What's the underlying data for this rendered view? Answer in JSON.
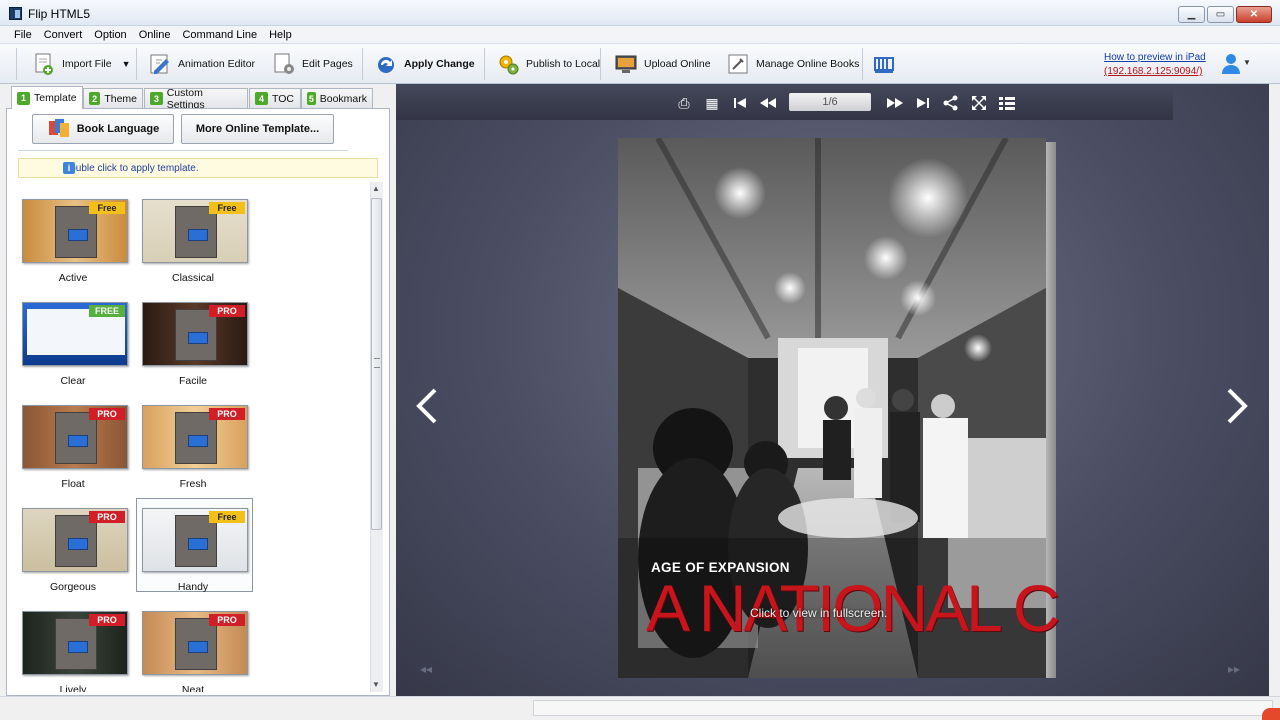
{
  "window": {
    "title": "Flip HTML5",
    "min_glyph": "▁",
    "max_glyph": "▭",
    "close_glyph": "✕"
  },
  "menu": [
    "File",
    "Convert",
    "Option",
    "Online",
    "Command Line",
    "Help"
  ],
  "toolbar": {
    "import_file": "Import File",
    "animation_editor": "Animation Editor",
    "edit_pages": "Edit Pages",
    "apply_change": "Apply Change",
    "publish_local": "Publish to Local",
    "upload_online": "Upload Online",
    "manage_online": "Manage Online Books",
    "help_link": "How to preview in iPad",
    "help_ip": "(192.168.2.125:9094/)"
  },
  "tabs": [
    {
      "num": "1",
      "label": "Template"
    },
    {
      "num": "2",
      "label": "Theme"
    },
    {
      "num": "3",
      "label": "Custom Settings"
    },
    {
      "num": "4",
      "label": "TOC"
    },
    {
      "num": "5",
      "label": "Bookmark"
    }
  ],
  "template_panel": {
    "book_language": "Book Language",
    "more_templates": "More Online Template...",
    "hint": "Double click to apply template.",
    "hint_icon": "i",
    "templates": [
      {
        "name": "Active",
        "badge": "Free"
      },
      {
        "name": "Classical",
        "badge": "Free"
      },
      {
        "name": "Clear",
        "badge": "FREE"
      },
      {
        "name": "Facile",
        "badge": "PRO"
      },
      {
        "name": "Float",
        "badge": "PRO"
      },
      {
        "name": "Fresh",
        "badge": "PRO"
      },
      {
        "name": "Gorgeous",
        "badge": "PRO"
      },
      {
        "name": "Handy",
        "badge": "Free"
      },
      {
        "name": "Lively",
        "badge": "PRO"
      },
      {
        "name": "Neat",
        "badge": "PRO"
      }
    ]
  },
  "preview": {
    "page_counter": "1/6",
    "cover_subtitle": "AGE OF EXPANSION",
    "cover_title": "A NATIONAL C",
    "cover_hint": "Click to view in fullscreen.",
    "nav_prev": "‹",
    "nav_next": "›",
    "first_glyph": "◂◂",
    "last_glyph": "▸▸",
    "icons": {
      "print": "⎙",
      "thumbs": "▦",
      "first": "⏮",
      "prev": "⏪",
      "next": "⏩",
      "last": "⏭",
      "share": "⋖",
      "fullscreen": "⤢",
      "menu": "☰"
    }
  },
  "colors": {
    "accent_green": "#4ea92b",
    "pro_red": "#d21e26",
    "free_yellow": "#f3c01a",
    "title_red": "#c8141b",
    "preview_bg": "#4b4e63"
  }
}
